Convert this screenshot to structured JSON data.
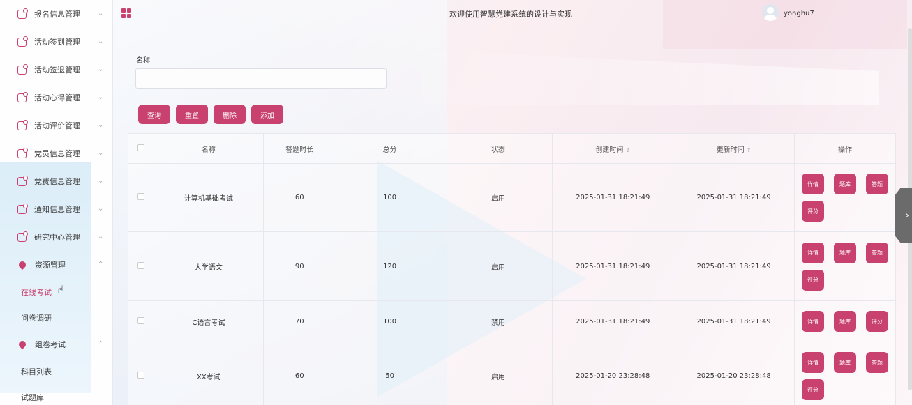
{
  "sidebar": {
    "items": [
      {
        "label": "报名信息管理"
      },
      {
        "label": "活动签到管理"
      },
      {
        "label": "活动签退管理"
      },
      {
        "label": "活动心得管理"
      },
      {
        "label": "活动评价管理"
      },
      {
        "label": "党员信息管理"
      },
      {
        "label": "党费信息管理"
      },
      {
        "label": "通知信息管理"
      },
      {
        "label": "研究中心管理"
      }
    ],
    "resource_group": {
      "label": "资源管理",
      "sub": [
        {
          "label": "在线考试"
        },
        {
          "label": "问卷调研"
        }
      ]
    },
    "exam_group": {
      "label": "组卷考试",
      "sub": [
        {
          "label": "科目列表"
        },
        {
          "label": "试题库"
        }
      ]
    }
  },
  "header": {
    "title": "欢迎使用智慧党建系统的设计与实现",
    "username": "yonghu7"
  },
  "search": {
    "label": "名称",
    "placeholder": ""
  },
  "toolbar": {
    "query": "查询",
    "reset": "重置",
    "delete": "删除",
    "add": "添加"
  },
  "table": {
    "headers": {
      "name": "名称",
      "duration": "答题时长",
      "total": "总分",
      "status": "状态",
      "created": "创建时间",
      "updated": "更新时间",
      "actions": "操作"
    },
    "ops": {
      "detail": "详情",
      "bank": "题库",
      "answers": "答题",
      "grade": "评分"
    },
    "rows": [
      {
        "name": "计算机基础考试",
        "duration": "60",
        "total": "100",
        "status": "启用",
        "created": "2025-01-31 18:21:49",
        "updated": "2025-01-31 18:21:49"
      },
      {
        "name": "大学语文",
        "duration": "90",
        "total": "120",
        "status": "启用",
        "created": "2025-01-31 18:21:49",
        "updated": "2025-01-31 18:21:49"
      },
      {
        "name": "C语言考试",
        "duration": "70",
        "total": "100",
        "status": "禁用",
        "created": "2025-01-31 18:21:49",
        "updated": "2025-01-31 18:21:49"
      },
      {
        "name": "XX考试",
        "duration": "60",
        "total": "50",
        "status": "启用",
        "created": "2025-01-20 23:28:48",
        "updated": "2025-01-20 23:28:48"
      }
    ]
  },
  "colors": {
    "accent": "#c9416f"
  }
}
